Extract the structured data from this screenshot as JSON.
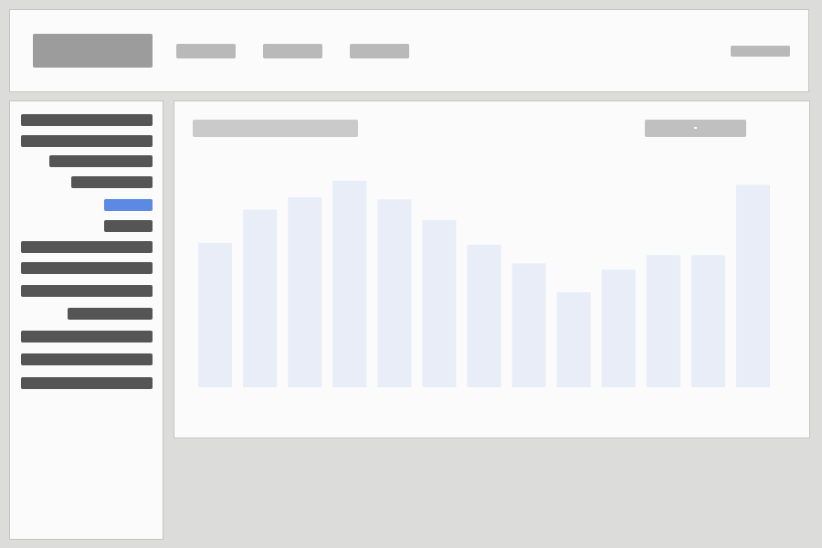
{
  "app": {
    "header": {
      "logo_icon": "logo-placeholder",
      "nav_items": [
        "nav-1",
        "nav-2",
        "nav-3"
      ],
      "account_link": "account-placeholder"
    },
    "sidebar": {
      "items": 13,
      "active_index": 4,
      "active_color": "#5b89e3"
    },
    "main": {
      "chart_title": "",
      "filter_dropdown": "chevron-down-icon"
    },
    "colors": {
      "page_bg": "#dcdddb",
      "panel_bg": "#fafbfa",
      "bar_fill": "#e8edf7",
      "accent": "#5b89e3"
    }
  },
  "chart_data": {
    "type": "bar",
    "title": "",
    "xlabel": "",
    "ylabel": "",
    "categories": [
      "",
      "",
      "",
      "",
      "",
      "",
      "",
      "",
      "",
      "",
      "",
      "",
      ""
    ],
    "series": [
      {
        "values": [
          0.7,
          0.86,
          0.92,
          1.0,
          0.91,
          0.81,
          0.69,
          0.6,
          0.46,
          0.57,
          0.64,
          0.64,
          0.98
        ]
      }
    ],
    "ylim": [
      0,
      1
    ],
    "grid": false,
    "legend": "none"
  }
}
